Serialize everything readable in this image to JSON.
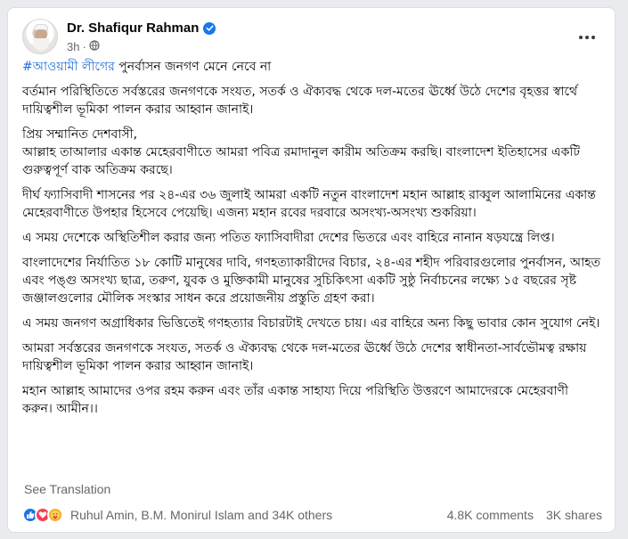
{
  "author": {
    "name": "Dr. Shafiqur Rahman",
    "time": "3h",
    "verified": true
  },
  "post": {
    "hashtag": "#আওয়ামী লীগের",
    "headline_rest": " পুনর্বাসন জনগণ মেনে নেবে না",
    "paragraphs": [
      "বর্তমান পরিস্থিতিতে সর্বস্তরের জনগণকে সংযত, সতর্ক ও ঐক্যবদ্ধ থেকে দল-মতের ঊর্ধ্বে উঠে দেশের বৃহত্তর স্বার্থে দায়িত্বশীল ভূমিকা পালন করার আহ্বান জানাই।",
      "প্রিয় সম্মানিত দেশবাসী,\nআল্লাহ তাআলার একান্ত মেহেরবাণীতে আমরা পবিত্র রমাদানুল কারীম অতিক্রম করছি। বাংলাদেশ ইতিহাসের একটি গুরুত্বপূর্ণ বাক অতিক্রম করছে।",
      "দীর্ঘ ফ্যাসিবাদী শাসনের পর ২৪-এর ৩৬ জুলাই আমরা একটি নতুন বাংলাদেশ মহান আল্লাহ রাব্বুল আলামিনের একান্ত মেহেরবাণীতে উপহার হিসেবে পেয়েছি। এজন্য মহান রবের দরবারে অসংখ্য-অসংখ্য শুকরিয়া।",
      "এ সময় দেশেকে অস্থিতিশীল করার জন্য পতিত ফ্যাসিবাদীরা দেশের ভিতরে এবং বাহিরে নানান ষড়যন্ত্রে লিপ্ত।",
      "বাংলাদেশের নির্যাতিত ১৮ কোটি মানুষের দাবি, গণহত্যাকারীদের বিচার, ২৪-এর শহীদ পরিবারগুলোর পুনর্বাসন, আহত এবং পঙ্গু অসংখ্য ছাত্র, তরুণ, যুবক ও মুক্তিকামী মানুষের সুচিকিৎসা একটি সুষ্ঠু নির্বাচনের লক্ষ্যে ১৫ বছরের সৃষ্ট জঞ্জালগুলোর মৌলিক সংস্কার সাধন করে প্রয়োজনীয় প্রস্তুতি গ্রহণ করা।",
      "এ সময় জনগণ অগ্রাধিকার ভিত্তিতেই গণহত্যার বিচারটাই দেখতে চায়। এর বাহিরে অন্য কিছু ভাবার কোন সুযোগ নেই।",
      "আমরা সর্বস্তরের জনগণকে সংযত, সতর্ক ও ঐক্যবদ্ধ থেকে দল-মতের ঊর্ধ্বে উঠে দেশের স্বাধীনতা-সার্বভৌমত্ব রক্ষায় দায়িত্বশীল ভূমিকা পালন করার আহ্বান জানাই।",
      "মহান আল্লাহ আমাদের ওপর রহম করুন এবং তাঁর একান্ত সাহায্য দিয়ে পরিস্থিতি উত্তরণে আমাদেরকে মেহেরবাণী করুন। আমীন।।"
    ]
  },
  "see_translation": "See Translation",
  "footer": {
    "reactors": "Ruhul Amin, B.M. Monirul Islam and 34K others",
    "comments": "4.8K comments",
    "shares": "3K shares"
  },
  "icons": [
    "verified-badge-icon",
    "globe-icon",
    "more-options-icon",
    "like-reaction-icon",
    "love-reaction-icon",
    "care-reaction-icon"
  ],
  "colors": {
    "accent": "#1877f2",
    "hashtag": "#216fdb",
    "muted": "#65676b",
    "text": "#050505"
  }
}
